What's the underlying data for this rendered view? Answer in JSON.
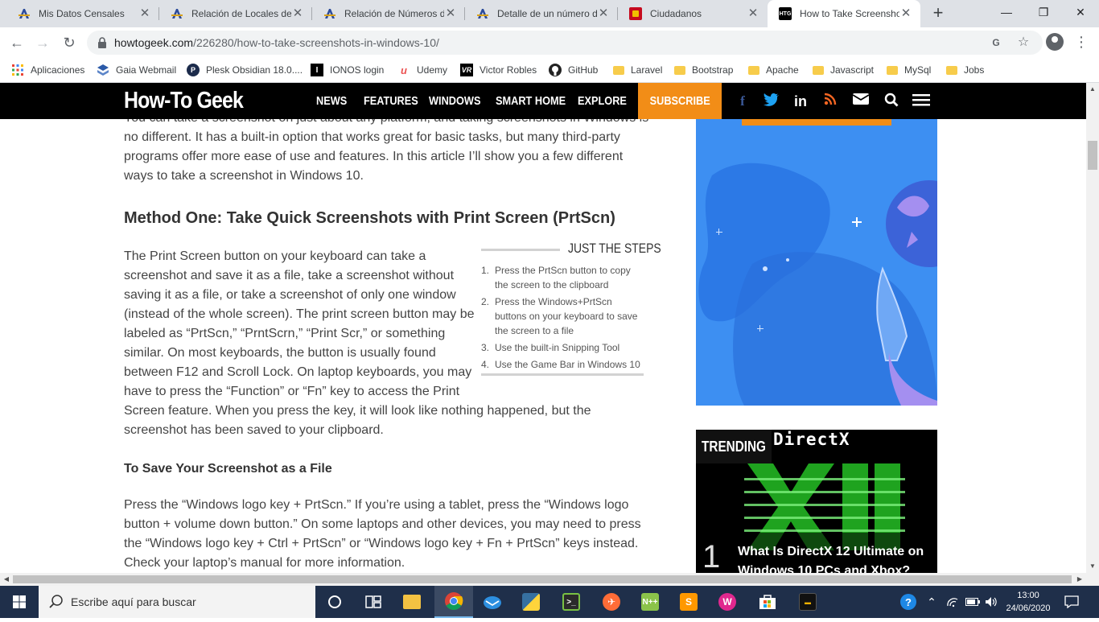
{
  "browser": {
    "tabs": [
      {
        "title": "Mis Datos Censales",
        "favicon": "aeat-icon",
        "color": "#2d4b9a"
      },
      {
        "title": "Relación de Locales de",
        "favicon": "aeat-icon",
        "color": "#2d4b9a"
      },
      {
        "title": "Relación de Números d",
        "favicon": "aeat-icon",
        "color": "#2d4b9a"
      },
      {
        "title": "Detalle de un número d",
        "favicon": "aeat-icon",
        "color": "#2d4b9a"
      },
      {
        "title": "Ciudadanos",
        "favicon": "spain-crest-icon",
        "color": "#c60b1e"
      },
      {
        "title": "How to Take Screensho",
        "favicon": "htg-icon",
        "color": "#000000",
        "active": true
      }
    ],
    "url_host": "howtogeek.com",
    "url_path": "/226280/how-to-take-screenshots-in-windows-10/",
    "bookmarks": [
      {
        "label": "Aplicaciones",
        "icon": "apps-grid-icon"
      },
      {
        "label": "Gaia Webmail",
        "icon": "gaia-icon"
      },
      {
        "label": "Plesk Obsidian 18.0....",
        "icon": "plesk-icon"
      },
      {
        "label": "IONOS login",
        "icon": "ionos-icon"
      },
      {
        "label": "Udemy",
        "icon": "udemy-icon"
      },
      {
        "label": "Victor Robles",
        "icon": "vr-icon"
      },
      {
        "label": "GitHub",
        "icon": "github-icon"
      },
      {
        "label": "Laravel",
        "icon": "folder-icon"
      },
      {
        "label": "Bootstrap",
        "icon": "folder-icon"
      },
      {
        "label": "Apache",
        "icon": "folder-icon"
      },
      {
        "label": "Javascript",
        "icon": "folder-icon"
      },
      {
        "label": "MySql",
        "icon": "folder-icon"
      },
      {
        "label": "Jobs",
        "icon": "folder-icon"
      }
    ]
  },
  "site": {
    "logo": "How-To Geek",
    "nav": [
      "NEWS",
      "FEATURES",
      "WINDOWS",
      "SMART HOME",
      "EXPLORE"
    ],
    "subscribe": "SUBSCRIBE",
    "social": [
      "facebook-icon",
      "twitter-icon",
      "linkedin-icon",
      "rss-icon",
      "mail-icon",
      "search-icon",
      "hamburger-menu-icon"
    ],
    "accent": "#f28d17"
  },
  "article": {
    "intro": "You can take a screenshot on just about any platform, and taking screenshots in Windows is no different. It has a built-in option that works great for basic tasks, but many third-party programs offer more ease of use and features. In this article I’ll show you a few different ways to take a screenshot in Windows 10.",
    "heading": "Method One: Take Quick Screenshots with Print Screen (PrtScn)",
    "p1a": "The Print Screen button on your keyboard can take a screenshot and save it as a file, take a screenshot without saving it as a file, or take a screenshot of only one window (instead of the whole screen). The print screen button may be labeled as “PrtScn,” “PrntScrn,” “Print Scr,” or something similar. On most keyboards, the button is usually found between F12 and Scroll Lock. On laptop keyboards, you may have to press the “Function” or “Fn” key to access the Print",
    "p1b": "Screen feature. When you press the key, it will look like nothing happened, but the screenshot has been saved to your clipboard.",
    "subheading": "To Save Your Screenshot as a File",
    "p2": "Press the “Windows logo key + PrtScn.” If you’re using a tablet, press the “Windows logo button + volume down button.” On some laptops and other devices, you may need to press the “Windows logo key + Ctrl + PrtScn” or “Windows logo key + Fn + PrtScn” keys instead. Check your laptop’s manual for more information.",
    "steps_title": "JUST THE STEPS",
    "steps": [
      "Press the PrtScn button to copy the screen to the clipboard",
      "Press the Windows+PrtScn buttons on your keyboard to save the screen to a file",
      "Use the built-in Snipping Tool",
      "Use the Game Bar in Windows 10"
    ]
  },
  "sidebar": {
    "trending_label": "TRENDING",
    "trending_image_text": "DirectX",
    "trending_number": "1",
    "trending_title": "What Is DirectX 12 Ultimate on Windows 10 PCs and Xbox?"
  },
  "taskbar": {
    "search_placeholder": "Escribe aquí para buscar",
    "apps": [
      {
        "name": "cortana-icon"
      },
      {
        "name": "task-view-icon"
      },
      {
        "name": "file-explorer-icon"
      },
      {
        "name": "chrome-icon",
        "active": true
      },
      {
        "name": "thunderbird-icon"
      },
      {
        "name": "python-icon"
      },
      {
        "name": "terminal-icon"
      },
      {
        "name": "postman-icon"
      },
      {
        "name": "notepad-plus-plus-icon"
      },
      {
        "name": "sublime-text-icon"
      },
      {
        "name": "wamp-icon"
      },
      {
        "name": "microsoft-store-icon"
      },
      {
        "name": "photo-viewer-icon"
      }
    ],
    "time": "13:00",
    "date": "24/06/2020"
  }
}
